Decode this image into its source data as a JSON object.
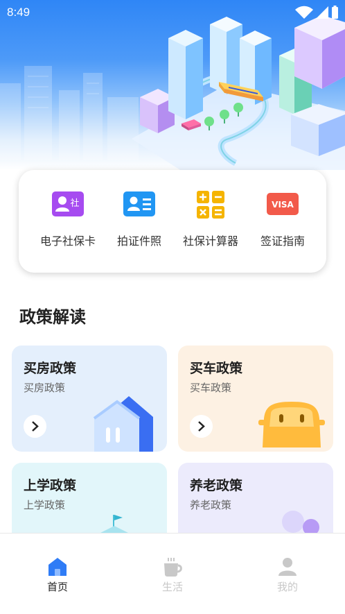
{
  "status_bar": {
    "time": "8:49"
  },
  "quick_actions": [
    {
      "label": "电子社保卡",
      "icon": "social-security-card-icon",
      "color": "#a64bf0",
      "glyph": "社"
    },
    {
      "label": "拍证件照",
      "icon": "id-photo-icon",
      "color": "#2196f3"
    },
    {
      "label": "社保计算器",
      "icon": "calculator-icon",
      "color": "#f5b400"
    },
    {
      "label": "签证指南",
      "icon": "visa-icon",
      "color": "#f25a4a",
      "glyph": "VISA"
    }
  ],
  "section": {
    "title": "政策解读"
  },
  "policies": [
    {
      "title": "买房政策",
      "subtitle": "买房政策",
      "icon": "house-icon",
      "bg": "#e4effc"
    },
    {
      "title": "买车政策",
      "subtitle": "买车政策",
      "icon": "car-icon",
      "bg": "#fdf1e3"
    },
    {
      "title": "上学政策",
      "subtitle": "上学政策",
      "icon": "school-icon",
      "bg": "#e2f6fa"
    },
    {
      "title": "养老政策",
      "subtitle": "养老政策",
      "icon": "elderly-icon",
      "bg": "#ecebfc"
    }
  ],
  "bottom_nav": [
    {
      "label": "首页",
      "icon": "home-icon",
      "active": true
    },
    {
      "label": "生活",
      "icon": "cup-icon",
      "active": false
    },
    {
      "label": "我的",
      "icon": "profile-icon",
      "active": false
    }
  ],
  "colors": {
    "accent": "#2f7cf6",
    "inactive": "#c8c8c8"
  }
}
